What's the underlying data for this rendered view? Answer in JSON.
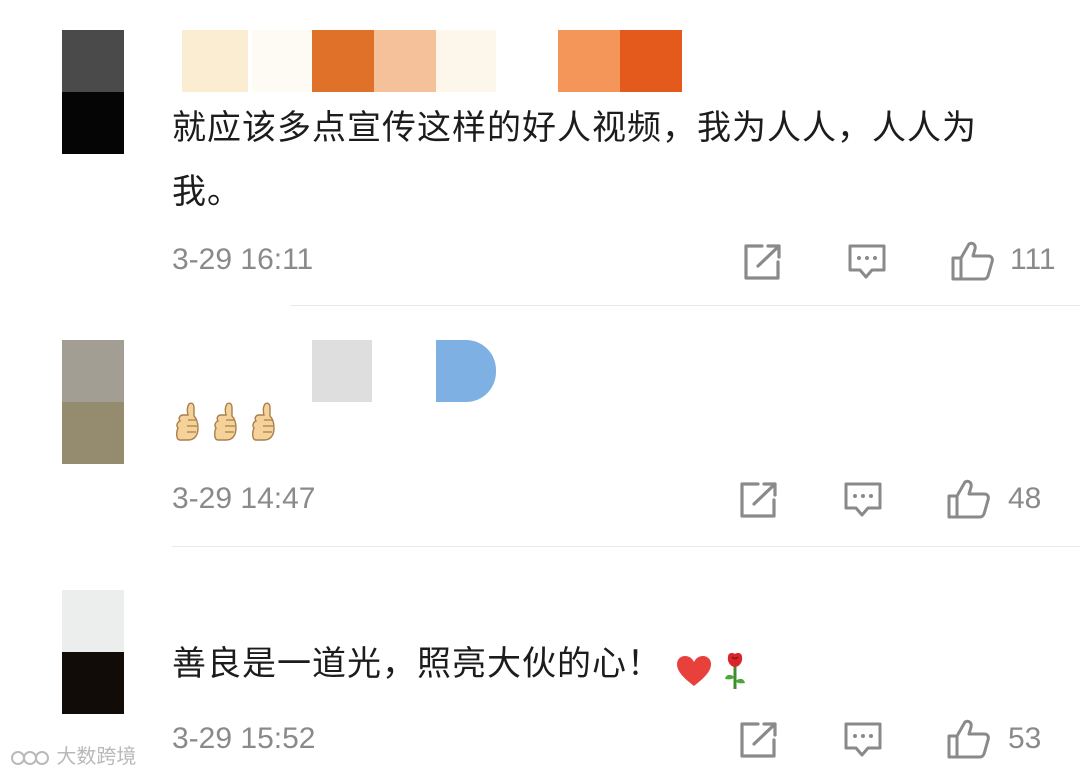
{
  "comments": [
    {
      "text": "就应该多点宣传这样的好人视频，我为人人，人人为我。",
      "time": "3-29 16:11",
      "likes": "111",
      "avatar_colors": [
        "#4a4a4a",
        "#050505"
      ],
      "name_colors": [
        "#fbedd2",
        "#fefaf4",
        "#e07129",
        "#f4c19a",
        "#fdf6ea",
        "#f4965a",
        "#e35a1c"
      ]
    },
    {
      "text": "",
      "time": "3-29 14:47",
      "likes": "48",
      "avatar_colors": [
        "#a29e94",
        "#958b6e"
      ],
      "name_colors": [
        "#dedede",
        "#7fb0e4"
      ]
    },
    {
      "text": "善良是一道光，照亮大伙的心！",
      "time": "3-29 15:52",
      "likes": "53",
      "avatar_colors": [
        "#eceeee",
        "#120c08"
      ],
      "name_colors": []
    }
  ],
  "icons": {
    "forward": "share-square-icon",
    "reply": "comment-bubble-icon",
    "like": "thumbs-up-icon",
    "thumb_emoji": "thumbs-up-emoji",
    "heart_emoji": "red-heart-emoji",
    "rose_emoji": "rose-emoji"
  },
  "watermark": {
    "text": "大数跨境"
  },
  "colors": {
    "meta_gray": "#8a8a8a",
    "text": "#1c1c1c",
    "heart": "#e8403a"
  }
}
